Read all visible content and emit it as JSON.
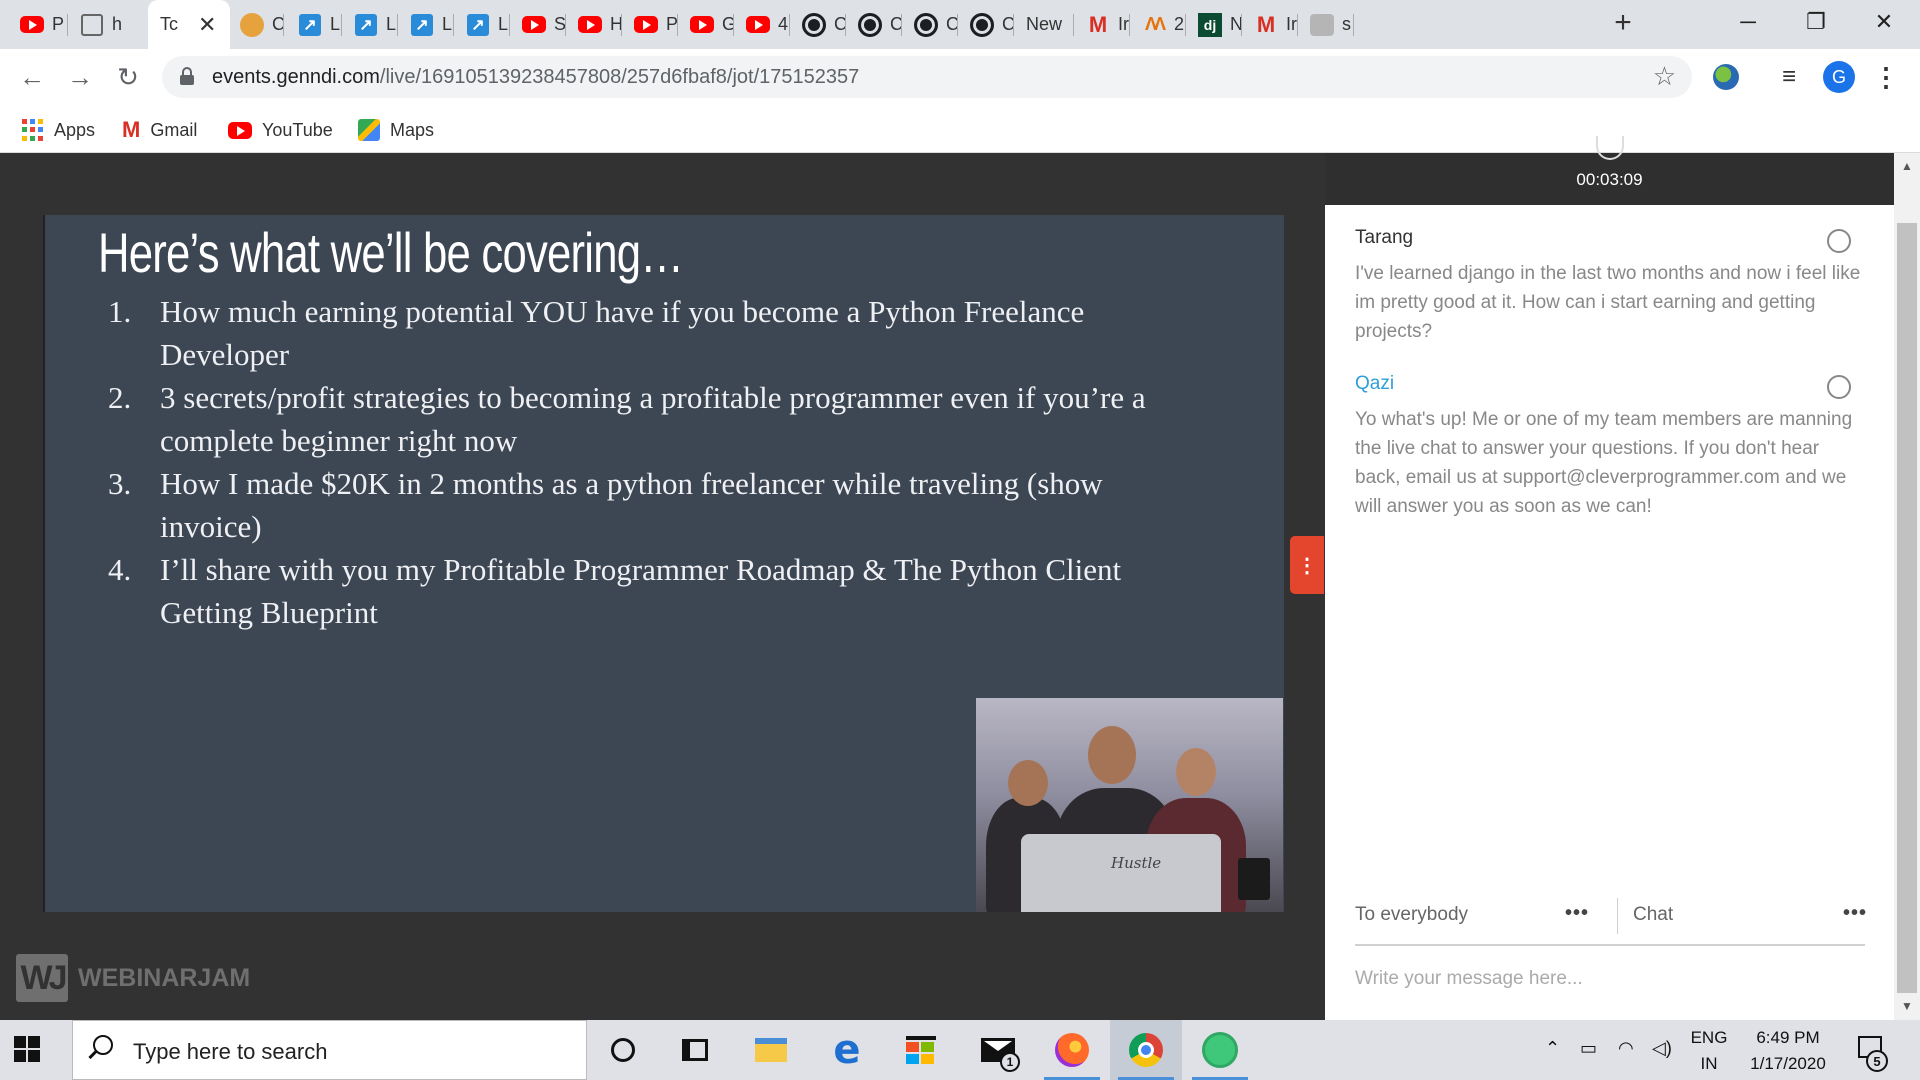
{
  "browser": {
    "tabs": [
      {
        "icon": "youtube-icon",
        "title": "P"
      },
      {
        "icon": "page-icon",
        "title": "h"
      },
      {
        "icon": "page-icon",
        "title": "Tc",
        "active": true
      },
      {
        "icon": "avatar-icon",
        "title": "C"
      },
      {
        "icon": "app-icon",
        "title": "L"
      },
      {
        "icon": "app-icon",
        "title": "L"
      },
      {
        "icon": "app-icon",
        "title": "L"
      },
      {
        "icon": "app-icon",
        "title": "L"
      },
      {
        "icon": "youtube-icon",
        "title": "S"
      },
      {
        "icon": "youtube-icon",
        "title": "H"
      },
      {
        "icon": "youtube-icon",
        "title": "P"
      },
      {
        "icon": "youtube-icon",
        "title": "G"
      },
      {
        "icon": "youtube-icon",
        "title": "4"
      },
      {
        "icon": "github-icon",
        "title": "C"
      },
      {
        "icon": "github-icon",
        "title": "C"
      },
      {
        "icon": "github-icon",
        "title": "C"
      },
      {
        "icon": "github-icon",
        "title": "C"
      },
      {
        "icon": "",
        "title": "New"
      },
      {
        "icon": "gmail-icon",
        "title": "Ir"
      },
      {
        "icon": "multi-icon",
        "title": "2"
      },
      {
        "icon": "django-icon",
        "title": "N"
      },
      {
        "icon": "gmail-icon",
        "title": "Ir"
      },
      {
        "icon": "gray-icon",
        "title": "s"
      }
    ],
    "url_domain": "events.genndi.com",
    "url_path": "/live/169105139238457808/257d6fbaf8/jot/175152357",
    "profile_initial": "G",
    "bookmarks": [
      {
        "icon": "apps-grid-icon",
        "label": "Apps"
      },
      {
        "icon": "gmail-icon",
        "label": "Gmail"
      },
      {
        "icon": "youtube-icon",
        "label": "YouTube"
      },
      {
        "icon": "maps-icon",
        "label": "Maps"
      }
    ]
  },
  "slide": {
    "title": "Here’s what we’ll be covering…",
    "items": [
      {
        "num": "1.",
        "text": "How much earning potential YOU have if you become a Python Freelance Developer"
      },
      {
        "num": "2.",
        "text": "3 secrets/profit strategies to becoming a profitable programmer even if you’re a complete beginner right now"
      },
      {
        "num": "3.",
        "text": "How I made $20K in 2 months as a python freelancer while traveling (show invoice)"
      },
      {
        "num": "4.",
        "text": "I’ll share with you my Profitable Programmer Roadmap & The Python Client Getting Blueprint"
      }
    ],
    "camera_caption": "Hustle"
  },
  "branding": {
    "logo_mark": "WJ",
    "logo_text": "WEBINARJAM"
  },
  "chat": {
    "timer": "00:03:09",
    "messages": [
      {
        "author": "Tarang",
        "text": "I've learned django in the last two months and now i feel like im pretty good at it. How can i start earning and getting projects?"
      },
      {
        "author": "Qazi",
        "text": "Yo what's up! Me or one of my team members are manning the live chat to answer your questions. If you don't hear back, email us at support@cleverprogrammer.com and we will answer you as soon as we can!"
      }
    ],
    "recipient": "To everybody",
    "channel": "Chat",
    "more_label": "•••",
    "input_placeholder": "Write your message here..."
  },
  "taskbar": {
    "search_placeholder": "Type here to search",
    "mail_badge": "1",
    "language": "ENG",
    "region": "IN",
    "time": "6:49 PM",
    "date": "1/17/2020",
    "notification_count": "5"
  }
}
